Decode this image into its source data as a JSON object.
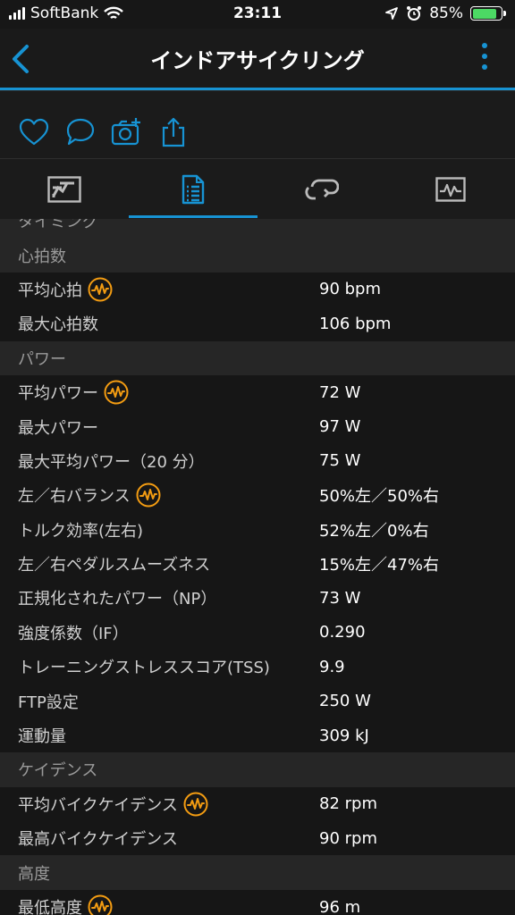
{
  "status_bar": {
    "carrier": "SoftBank",
    "time": "23:11",
    "battery": "85%",
    "battery_level": 0.85
  },
  "nav": {
    "title": "インドアサイクリング"
  },
  "colors": {
    "accent": "#1793d3",
    "highlight": "#f39c12"
  },
  "actions": [
    {
      "icon": "heart-icon"
    },
    {
      "icon": "comment-icon"
    },
    {
      "icon": "add-photo-icon"
    },
    {
      "icon": "share-icon"
    }
  ],
  "tabs": [
    {
      "icon": "summary-map-icon"
    },
    {
      "icon": "details-list-icon",
      "active": true
    },
    {
      "icon": "laps-icon"
    },
    {
      "icon": "charts-icon"
    }
  ],
  "rows": [
    {
      "type": "section",
      "label": "タイミング"
    },
    {
      "type": "section",
      "label": "心拍数"
    },
    {
      "type": "item",
      "label": "平均心拍",
      "value": "90 bpm",
      "chart_icon": true
    },
    {
      "type": "item",
      "label": "最大心拍数",
      "value": "106 bpm",
      "chart_icon": false
    },
    {
      "type": "section",
      "label": "パワー"
    },
    {
      "type": "item",
      "label": "平均パワー",
      "value": "72 W",
      "chart_icon": true
    },
    {
      "type": "item",
      "label": "最大パワー",
      "value": "97 W",
      "chart_icon": false
    },
    {
      "type": "item",
      "label": "最大平均パワー（20 分）",
      "value": "75 W",
      "chart_icon": false
    },
    {
      "type": "item",
      "label": "左／右バランス",
      "value": "50%左／50%右",
      "chart_icon": true
    },
    {
      "type": "item",
      "label": "トルク効率(左右)",
      "value": "52%左／0%右",
      "chart_icon": false
    },
    {
      "type": "item",
      "label": "左／右ペダルスムーズネス",
      "value": "15%左／47%右",
      "chart_icon": false
    },
    {
      "type": "item",
      "label": "正規化されたパワー（NP）",
      "value": "73 W",
      "chart_icon": false
    },
    {
      "type": "item",
      "label": "強度係数（IF）",
      "value": "0.290",
      "chart_icon": false
    },
    {
      "type": "item",
      "label": "トレーニングストレススコア(TSS)",
      "value": "9.9",
      "chart_icon": false
    },
    {
      "type": "item",
      "label": "FTP設定",
      "value": "250 W",
      "chart_icon": false
    },
    {
      "type": "item",
      "label": "運動量",
      "value": "309 kJ",
      "chart_icon": false
    },
    {
      "type": "section",
      "label": "ケイデンス"
    },
    {
      "type": "item",
      "label": "平均バイクケイデンス",
      "value": "82 rpm",
      "chart_icon": true
    },
    {
      "type": "item",
      "label": "最高バイクケイデンス",
      "value": "90 rpm",
      "chart_icon": false
    },
    {
      "type": "section",
      "label": "高度"
    },
    {
      "type": "item",
      "label": "最低高度",
      "value": "96 m",
      "chart_icon": true
    }
  ]
}
